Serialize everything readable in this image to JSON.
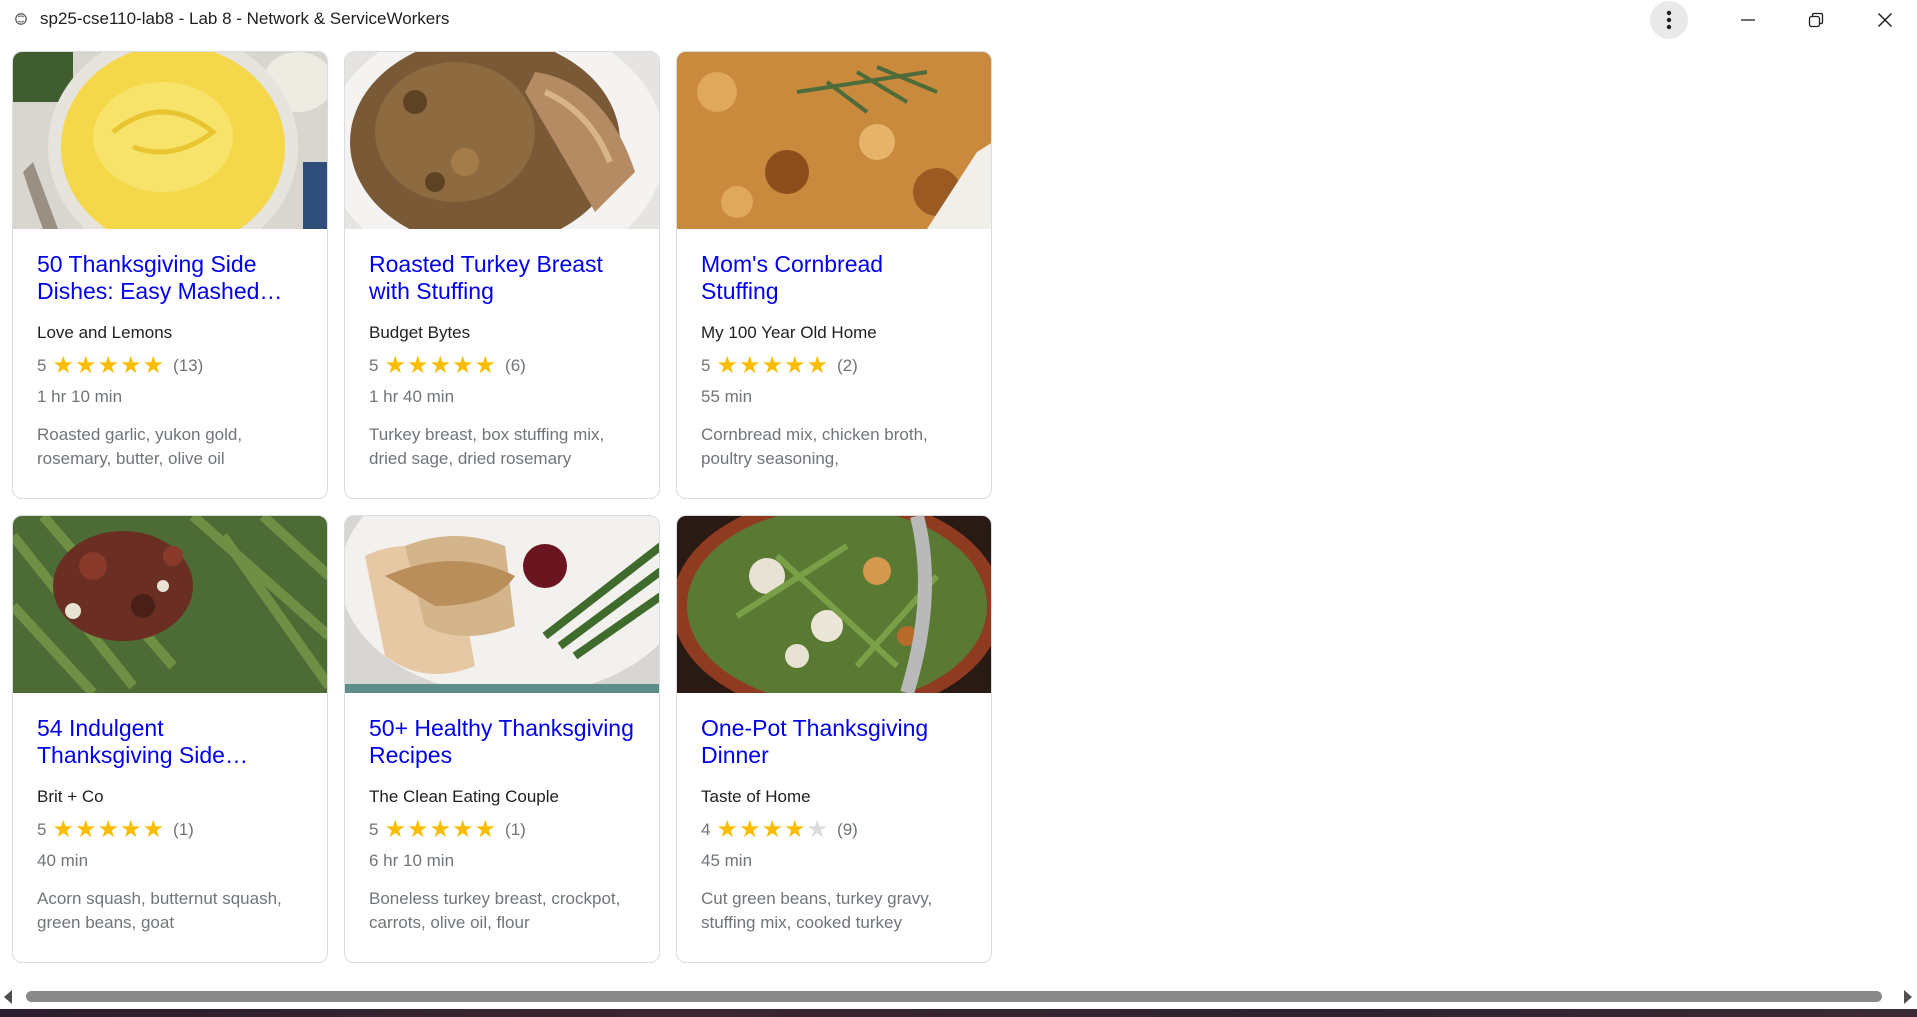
{
  "window": {
    "title": "sp25-cse110-lab8 - Lab 8 - Network & ServiceWorkers",
    "icons": {
      "app": "globe-icon",
      "menu": "more-vert-icon",
      "minimize": "minimize-icon",
      "maximize": "restore-icon",
      "close": "close-icon"
    }
  },
  "colors": {
    "link": "#0000ee",
    "star": "#fbbc04",
    "star_empty": "#dadce0",
    "muted_text": "#70757a"
  },
  "recipes": [
    {
      "title": "50 Thanksgiving Side Dishes: Easy Mashed…",
      "source": "Love and Lemons",
      "rating": "5",
      "stars": 5,
      "review_count": "(13)",
      "time": "1 hr 10 min",
      "ingredients": "Roasted garlic, yukon gold, rosemary, butter, olive oil",
      "image": "mashed-potatoes-photo"
    },
    {
      "title": "Roasted Turkey Breast with Stuffing",
      "source": "Budget Bytes",
      "rating": "5",
      "stars": 5,
      "review_count": "(6)",
      "time": "1 hr 40 min",
      "ingredients": "Turkey breast, box stuffing mix, dried sage, dried rosemary",
      "image": "turkey-stuffing-photo"
    },
    {
      "title": "Mom's Cornbread Stuffing",
      "source": "My 100 Year Old Home",
      "rating": "5",
      "stars": 5,
      "review_count": "(2)",
      "time": "55 min",
      "ingredients": "Cornbread mix, chicken broth, poultry seasoning,",
      "image": "cornbread-stuffing-photo"
    },
    {
      "title": "54 Indulgent Thanksgiving Side…",
      "source": "Brit + Co",
      "rating": "5",
      "stars": 5,
      "review_count": "(1)",
      "time": "40 min",
      "ingredients": "Acorn squash, butternut squash, green beans, goat",
      "image": "green-beans-pecans-photo"
    },
    {
      "title": "50+ Healthy Thanksgiving Recipes",
      "source": "The Clean Eating Couple",
      "rating": "5",
      "stars": 5,
      "review_count": "(1)",
      "time": "6 hr 10 min",
      "ingredients": "Boneless turkey breast, crockpot, carrots, olive oil, flour",
      "image": "sliced-turkey-gravy-photo"
    },
    {
      "title": "One-Pot Thanksgiving Dinner",
      "source": "Taste of Home",
      "rating": "4",
      "stars": 4,
      "review_count": "(9)",
      "time": "45 min",
      "ingredients": "Cut green beans, turkey gravy, stuffing mix, cooked turkey",
      "image": "one-pot-dinner-photo"
    }
  ]
}
